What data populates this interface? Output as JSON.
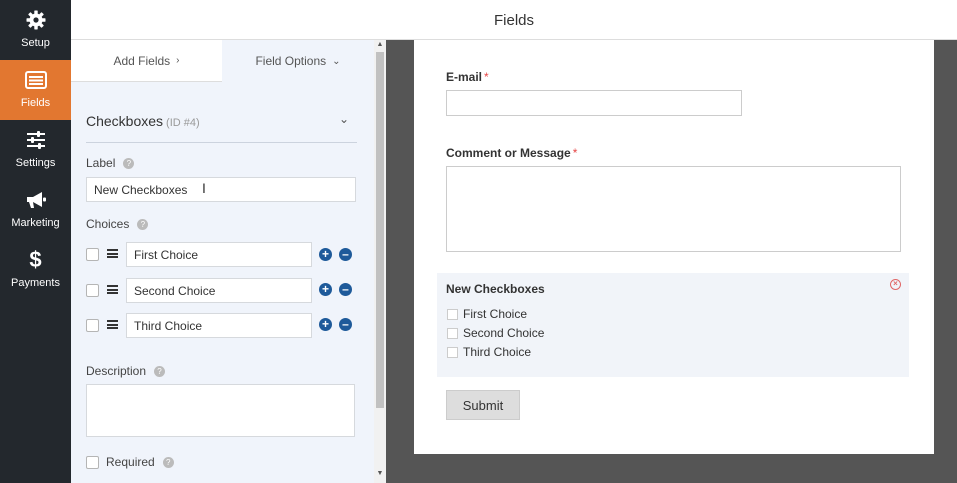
{
  "nav": {
    "items": [
      {
        "label": "Setup",
        "icon": "gear-icon"
      },
      {
        "label": "Fields",
        "icon": "fields-list-icon",
        "active": true
      },
      {
        "label": "Settings",
        "icon": "sliders-icon"
      },
      {
        "label": "Marketing",
        "icon": "megaphone-icon"
      },
      {
        "label": "Payments",
        "icon": "dollar-icon"
      }
    ],
    "active_color": "#e27730"
  },
  "header": {
    "title": "Fields"
  },
  "panel": {
    "tabs": {
      "add_fields": "Add Fields",
      "field_options": "Field Options"
    },
    "section": {
      "title": "Checkboxes",
      "id_text": "(ID #4)"
    },
    "label_field": {
      "label": "Label",
      "value": "New Checkboxes"
    },
    "choices": {
      "label": "Choices",
      "items": [
        "First Choice",
        "Second Choice",
        "Third Choice"
      ]
    },
    "description": {
      "label": "Description",
      "value": ""
    },
    "required": {
      "label": "Required",
      "checked": false
    }
  },
  "preview": {
    "email": {
      "label": "E-mail",
      "required_mark": "*"
    },
    "comment": {
      "label": "Comment or Message",
      "required_mark": "*"
    },
    "checkboxes": {
      "title": "New Checkboxes",
      "options": [
        "First Choice",
        "Second Choice",
        "Third Choice"
      ]
    },
    "submit_label": "Submit"
  }
}
